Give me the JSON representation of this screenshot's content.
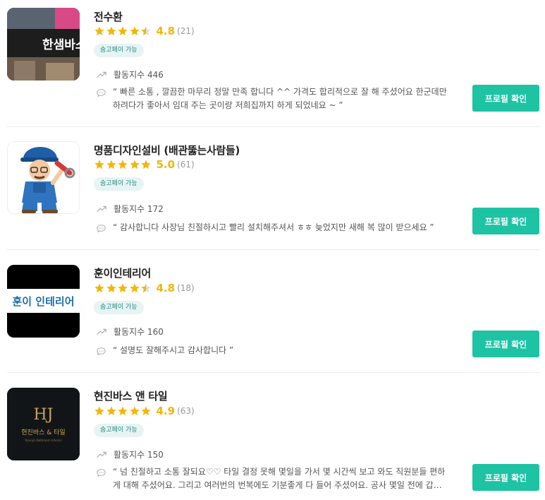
{
  "icons": {
    "star": "star-icon",
    "half_star": "star-half-icon",
    "activity": "trend-up-icon",
    "review": "speech-bubble-icon"
  },
  "colors": {
    "accent": "#1ec3a4",
    "star": "#f2b705",
    "badge_bg": "#e6f4f3",
    "badge_text": "#2a8a80"
  },
  "experts": [
    {
      "name": "전수환",
      "stars": 4.5,
      "rating": "4.8",
      "review_count": "(21)",
      "badge": "숨고페이 가능",
      "activity": "활동지수 446",
      "review": "“ 빠른 소통 , 깔끔한 마무리 정말 만족 합니다 ^^ 가격도 합리적으로 잘 해 주셨어요 한군데만 하려다가 좋아서 임대 주는 곳이랑 저희집까지 하게 되었네요 ~ ”",
      "button": "프로필 확인",
      "thumb_sign": "한샘바스"
    },
    {
      "name": "명품디자인설비 (배관뚫는사람들)",
      "stars": 5,
      "rating": "5.0",
      "review_count": "(61)",
      "badge": "숨고페이 가능",
      "activity": "활동지수 172",
      "review": "“ 감사합니다 사장님 친절하시고 빨리 설치해주셔서 ㅎㅎ 늦었지만 새해 복 많이 받으세요 ”",
      "button": "프로필 확인"
    },
    {
      "name": "훈이인테리어",
      "stars": 4.5,
      "rating": "4.8",
      "review_count": "(18)",
      "badge": "숨고페이 가능",
      "activity": "활동지수 160",
      "review": "“ 설명도 잘해주시고 감사합니다 ”",
      "button": "프로필 확인",
      "thumb_text": "훈이 인테리어"
    },
    {
      "name": "현진바스 앤 타일",
      "stars": 5,
      "rating": "4.9",
      "review_count": "(63)",
      "badge": "숨고페이 가능",
      "activity": "활동지수 150",
      "review": "“ 넘 친절하고 소통 잘되요♡♡ 타일 결정 못해 몇일을 가서 몇 시간씩 보고 와도 직원분들 편하게 대해 주셨어요. 그리고 여러번의 번복에도 기분좋게 다 들어 주셨어요. 공사 몇일 전에 갑자기 ...”",
      "button": "프로필 확인",
      "thumb_logo": "HJ",
      "thumb_text": "현진바스 & 타일",
      "thumb_sub": "Hyunjin Bathroom Interior"
    }
  ]
}
